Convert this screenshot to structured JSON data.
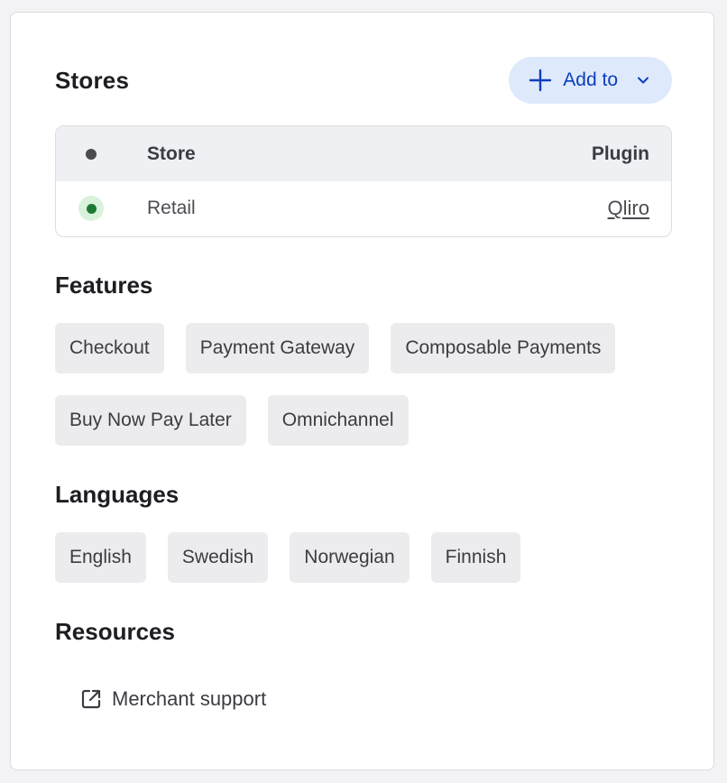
{
  "stores": {
    "title": "Stores",
    "add_button_label": "Add to",
    "table": {
      "headers": {
        "store": "Store",
        "plugin": "Plugin"
      },
      "rows": [
        {
          "store": "Retail",
          "plugin": "Qliro",
          "status_color": "#1e7a32"
        }
      ]
    }
  },
  "features": {
    "title": "Features",
    "items": [
      "Checkout",
      "Payment Gateway",
      "Composable Payments",
      "Buy Now Pay Later",
      "Omnichannel"
    ]
  },
  "languages": {
    "title": "Languages",
    "items": [
      "English",
      "Swedish",
      "Norwegian",
      "Finnish"
    ]
  },
  "resources": {
    "title": "Resources",
    "links": [
      {
        "label": "Merchant support",
        "icon": "external-link-icon"
      }
    ]
  },
  "colors": {
    "accent": "#0b3ebb",
    "accent_bg": "#dfe9fc",
    "chip_bg": "#ececee",
    "status_active": "#1e7a32"
  }
}
